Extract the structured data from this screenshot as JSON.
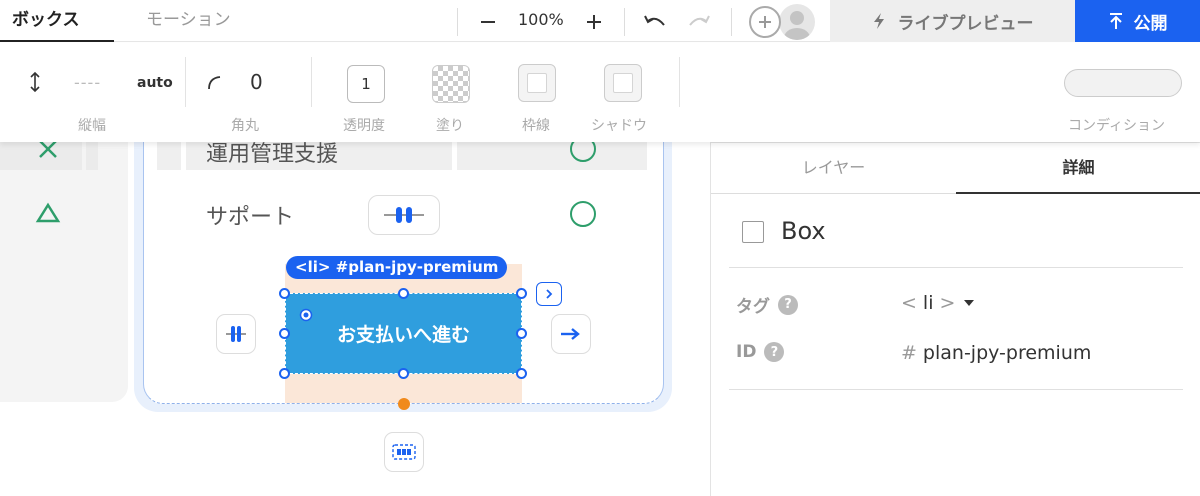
{
  "topbar": {
    "tabs": [
      {
        "label": "ボックス",
        "active": true
      },
      {
        "label": "モーション",
        "active": false
      }
    ],
    "zoom": "100%",
    "preview_label": "ライブプレビュー",
    "publish_label": "公開"
  },
  "toolbar": {
    "height_value": "----",
    "height_mode": "auto",
    "height_label": "縦幅",
    "radius_value": "0",
    "radius_label": "角丸",
    "opacity_value": "1",
    "opacity_label": "透明度",
    "fill_label": "塗り",
    "border_label": "枠線",
    "shadow_label": "シャドウ",
    "condition_label": "コンディション"
  },
  "canvas": {
    "row1_label": "運用管理支援",
    "support_label": "サポート",
    "selection_label": "<li> #plan-jpy-premium",
    "button_label": "お支払いへ進む"
  },
  "panel": {
    "tabs": [
      {
        "label": "レイヤー",
        "active": false
      },
      {
        "label": "詳細",
        "active": true
      }
    ],
    "element_type": "Box",
    "tag_label": "タグ",
    "tag_value": "li",
    "id_label": "ID",
    "id_value": "plan-jpy-premium",
    "colors": {
      "accent": "#1b62f0",
      "button_fill": "#2f9ede",
      "check_green": "#2e9e6b",
      "selection_bg": "#fbe7d8"
    }
  }
}
